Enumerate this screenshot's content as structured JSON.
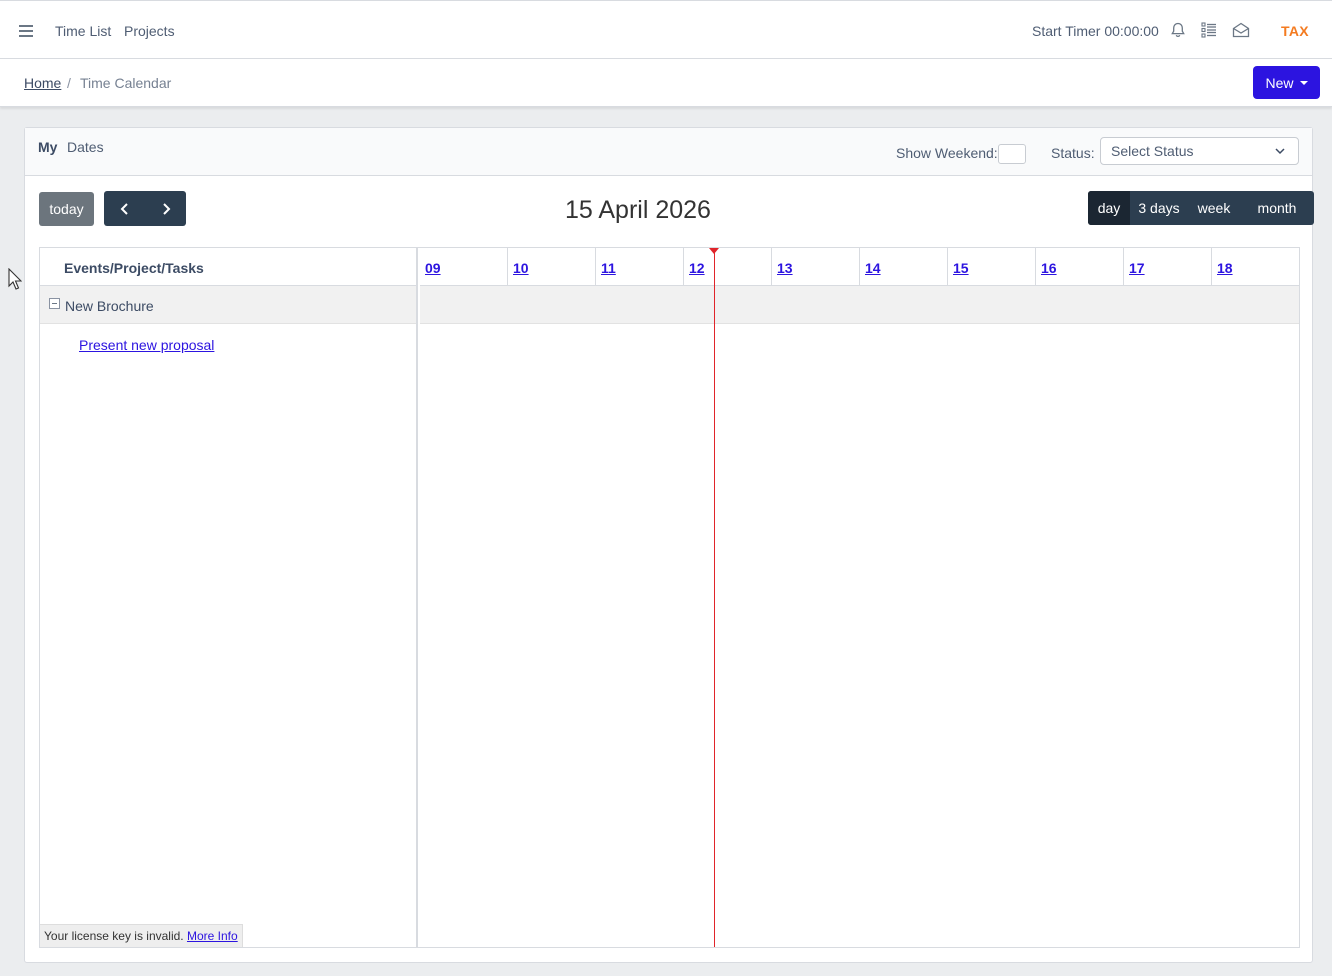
{
  "topbar": {
    "nav": [
      {
        "label": "Time List"
      },
      {
        "label": "Projects"
      }
    ],
    "timer_label": "Start Timer 00:00:00",
    "icons": [
      "menu-icon",
      "bell-icon",
      "list-icon",
      "mail-icon"
    ],
    "brand": "TAX",
    "brand_color": "#f47b20"
  },
  "breadcrumb": {
    "home": "Home",
    "separator": "/",
    "current": "Time Calendar"
  },
  "new_button": {
    "label": "New",
    "color": "#2c14e0"
  },
  "filters": {
    "my_label": "My",
    "dates_label": "Dates",
    "show_weekend_label": "Show Weekend:",
    "status_label": "Status:",
    "status_value": "Select Status"
  },
  "calendar": {
    "today_label": "today",
    "title": "15 April 2026",
    "views": [
      {
        "label": "day",
        "active": true
      },
      {
        "label": "3 days",
        "active": false
      },
      {
        "label": "week",
        "active": false
      },
      {
        "label": "month",
        "active": false
      }
    ],
    "resource_header": "Events/Project/Tasks",
    "days": [
      "09",
      "10",
      "11",
      "12",
      "13",
      "14",
      "15",
      "16",
      "17",
      "18"
    ],
    "group": "New Brochure",
    "task": "Present new proposal",
    "now_indicator_color": "#e0242a"
  },
  "license": {
    "text": "Your license key is invalid.",
    "link": "More Info"
  }
}
